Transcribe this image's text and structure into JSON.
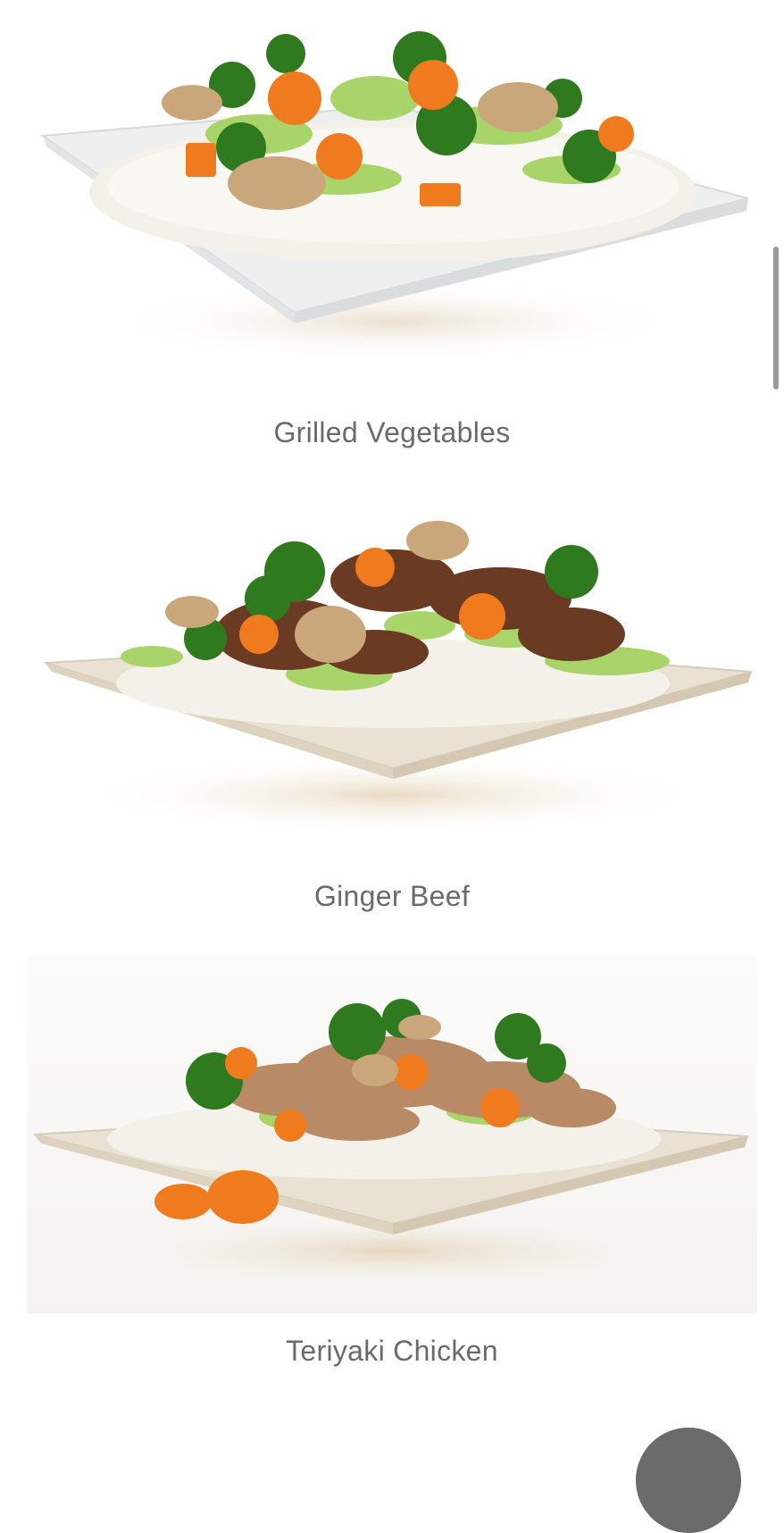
{
  "menu": {
    "items": [
      {
        "name": "Grilled Vegetables",
        "image_alt": "Grilled Vegetables dish"
      },
      {
        "name": "Ginger Beef",
        "image_alt": "Ginger Beef dish"
      },
      {
        "name": "Teriyaki Chicken",
        "image_alt": "Teriyaki Chicken dish"
      }
    ]
  },
  "colors": {
    "caption_text": "#6a6a6a",
    "rice": "#f3f1ea",
    "broccoli": "#2f7a1f",
    "carrot": "#f07a1e",
    "cabbage": "#a9d46a",
    "mushroom": "#c9a77b",
    "beef": "#6a3a22",
    "chicken": "#b88a66",
    "plate_white": "#eef0f0",
    "plate_cream": "#e9e1d2"
  }
}
